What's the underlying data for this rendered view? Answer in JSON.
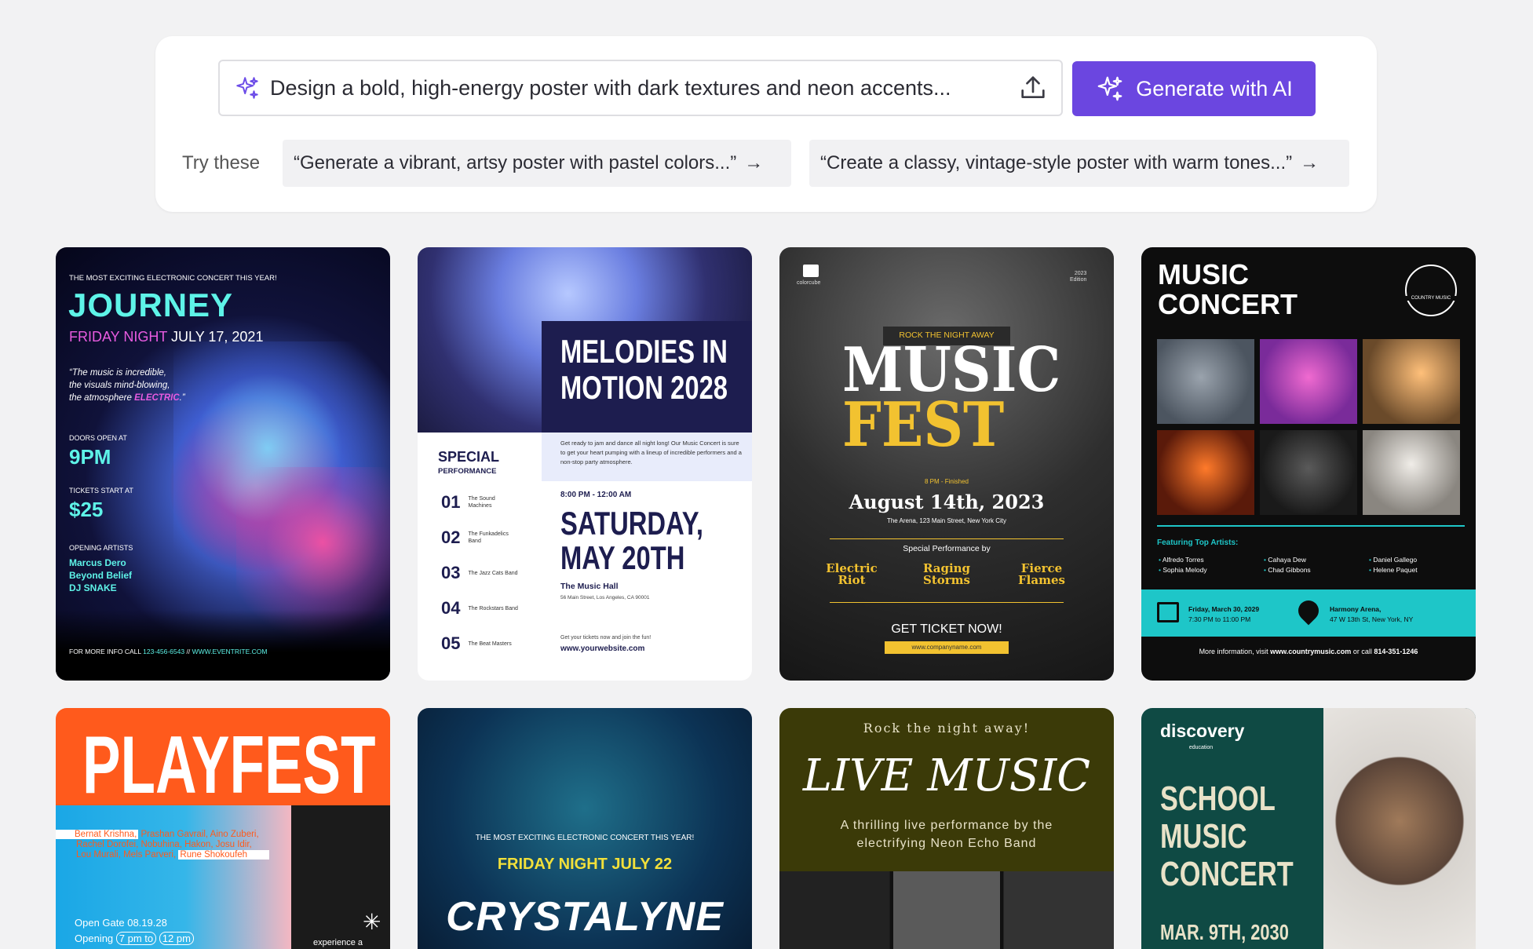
{
  "prompt": {
    "input_text": "Design a bold, high-energy poster with dark textures and neon accents...",
    "generate_label": "Generate with AI",
    "try_label": "Try these",
    "suggestions": [
      "“Generate a vibrant, artsy poster with pastel colors...”",
      "“Create a classy, vintage-style poster with warm tones...”"
    ]
  },
  "posters": {
    "journey": {
      "kicker": "THE MOST EXCITING ELECTRONIC CONCERT THIS YEAR!",
      "title": "JOURNEY",
      "date_a": "FRIDAY NIGHT",
      "date_b": "JULY 17, 2021",
      "quote_a": "“The music is incredible,",
      "quote_b": "the visuals mind-blowing,",
      "quote_c": "the atmosphere",
      "quote_d": "ELECTRIC",
      "quote_e": ".”",
      "doors_label": "DOORS OPEN AT",
      "doors": "9PM",
      "tickets_label": "TICKETS START AT",
      "tickets": "$25",
      "artists_label": "OPENING ARTISTS",
      "artist1": "Marcus Dero",
      "artist2": "Beyond Belief",
      "artist3": "DJ SNAKE",
      "footer_a": "FOR MORE INFO CALL",
      "footer_b": "123-456-6543",
      "footer_c": "//",
      "footer_d": "WWW.EVENTRITE.COM"
    },
    "melodies": {
      "title1": "MELODIES IN",
      "title2": "MOTION 2028",
      "special": "SPECIAL",
      "performance": "PERFORMANCE",
      "desc": "Get ready to jam and dance all night long! Our Music Concert is sure to get your heart pumping with a lineup of incredible performers and a non-stop party atmosphere.",
      "time": "8:00 PM - 12:00 AM",
      "day1": "SATURDAY,",
      "day2": "MAY 20TH",
      "venue": "The Music Hall",
      "address": "56 Main Street, Los Angeles, CA 90001",
      "cta": "Get your tickets now and join the fun!",
      "site": "www.yourwebsite.com",
      "acts": [
        {
          "num": "01",
          "name": "The Sound Machines"
        },
        {
          "num": "02",
          "name": "The Funkadelics Band"
        },
        {
          "num": "03",
          "name": "The Jazz Cats Band"
        },
        {
          "num": "04",
          "name": "The Rockstars Band"
        },
        {
          "num": "05",
          "name": "The Beat Masters"
        }
      ]
    },
    "musicfest": {
      "brand": "colorcube",
      "edition_a": "2023",
      "edition_b": "Edition",
      "tagline": "ROCK THE NIGHT AWAY",
      "title1": "MUSIC",
      "title2": "FEST",
      "time": "8 PM - Finished",
      "date": "August 14th, 2023",
      "venue": "The Arena, 123 Main Street, New York City",
      "special": "Special Performance by",
      "band1": "Electric Riot",
      "band2": "Raging Storms",
      "band3": "Fierce Flames",
      "cta": "GET TICKET NOW!",
      "site": "www.companyname.com"
    },
    "concert": {
      "title1": "MUSIC",
      "title2": "CONCERT",
      "badge": "COUNTRY MUSIC",
      "featuring": "Featuring Top Artists:",
      "artists": [
        "Alfredo Torres",
        "Sophia Melody",
        "Cahaya Dew",
        "Chad Gibbons",
        "Daniel Gallego",
        "Helene Paquet"
      ],
      "date_a": "Friday, March 30, 2029",
      "date_b": "7:30 PM to 11:00 PM",
      "venue_a": "Harmony Arena,",
      "venue_b": "47 W 13th St, New York, NY",
      "footer_a": "More information, visit",
      "footer_b": "www.countrymusic.com",
      "footer_c": "or call",
      "footer_d": "814-351-1246"
    },
    "playfest": {
      "title": "PLAYFEST",
      "names_a": "Bernat Krishna,",
      "names_b": "Prashan Gavrail, Aino Zuberi,",
      "names_c": "Rachel Dorofei, Nobuhina, Hakon, Josu Idir,",
      "names_d": "Lou Murali, Mels Parveri,",
      "names_e": "Rune Shokoufeh",
      "gate": "Open Gate 08.19.28",
      "opening_a": "Opening",
      "opening_b": "7 pm to",
      "opening_c": "12 pm",
      "side": "experience a"
    },
    "crystalyne": {
      "kicker": "THE MOST EXCITING ELECTRONIC CONCERT THIS YEAR!",
      "date": "FRIDAY NIGHT JULY 22",
      "title": "CRYSTALYNE"
    },
    "livemusic": {
      "kicker": "Rock the night away!",
      "title": "LIVE MUSIC",
      "desc1": "A thrilling live performance by the",
      "desc2": "electrifying Neon Echo Band"
    },
    "school": {
      "brand": "discovery",
      "brand_sub": "education",
      "title1": "SCHOOL",
      "title2": "MUSIC",
      "title3": "CONCERT",
      "date": "MAR. 9TH, 2030"
    }
  },
  "colors": {
    "accent": "#6b46e0",
    "page_bg": "#f2f2f3",
    "teal": "#1ec6c8",
    "gold": "#f2c230",
    "orange": "#ff5a1c"
  }
}
